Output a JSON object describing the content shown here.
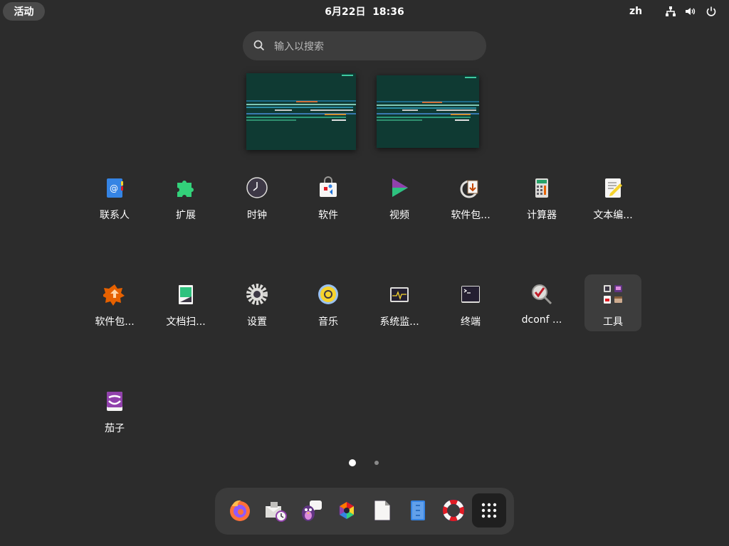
{
  "topbar": {
    "activities": "活动",
    "clock": "6月22日  18:36",
    "language": "zh",
    "network_icon": "network-wired-icon",
    "volume_icon": "volume-icon",
    "power_icon": "power-icon"
  },
  "search": {
    "placeholder": "输入以搜索"
  },
  "apps": [
    {
      "label": "联系人",
      "icon": "contacts-icon"
    },
    {
      "label": "扩展",
      "icon": "extensions-icon"
    },
    {
      "label": "时钟",
      "icon": "clock-icon"
    },
    {
      "label": "软件",
      "icon": "software-icon"
    },
    {
      "label": "视频",
      "icon": "videos-icon"
    },
    {
      "label": "软件包...",
      "icon": "package-updater-icon"
    },
    {
      "label": "计算器",
      "icon": "calculator-icon"
    },
    {
      "label": "文本编...",
      "icon": "text-editor-icon"
    },
    {
      "label": "软件包...",
      "icon": "package-installer-icon"
    },
    {
      "label": "文档扫...",
      "icon": "document-scanner-icon"
    },
    {
      "label": "设置",
      "icon": "settings-icon"
    },
    {
      "label": "音乐",
      "icon": "music-icon"
    },
    {
      "label": "系统监...",
      "icon": "system-monitor-icon"
    },
    {
      "label": "终端",
      "icon": "terminal-icon"
    },
    {
      "label": "dconf ...",
      "icon": "dconf-editor-icon"
    },
    {
      "label": "工具",
      "icon": "tools-folder-icon"
    },
    {
      "label": "茄子",
      "icon": "cheese-icon"
    }
  ],
  "pages": {
    "current": 1,
    "total": 2
  },
  "dash": [
    {
      "name": "firefox",
      "icon": "firefox-icon"
    },
    {
      "name": "evolution",
      "icon": "mail-calendar-icon"
    },
    {
      "name": "pidgin",
      "icon": "chat-icon"
    },
    {
      "name": "color-picker",
      "icon": "color-wheel-icon"
    },
    {
      "name": "document",
      "icon": "document-icon"
    },
    {
      "name": "archive",
      "icon": "archive-icon"
    },
    {
      "name": "help",
      "icon": "help-lifebuoy-icon"
    },
    {
      "name": "show-apps",
      "icon": "app-grid-icon"
    }
  ],
  "colors": {
    "background": "#2c2c2c",
    "workspace": "#0f3a33",
    "folder": "#3d3d3d"
  }
}
